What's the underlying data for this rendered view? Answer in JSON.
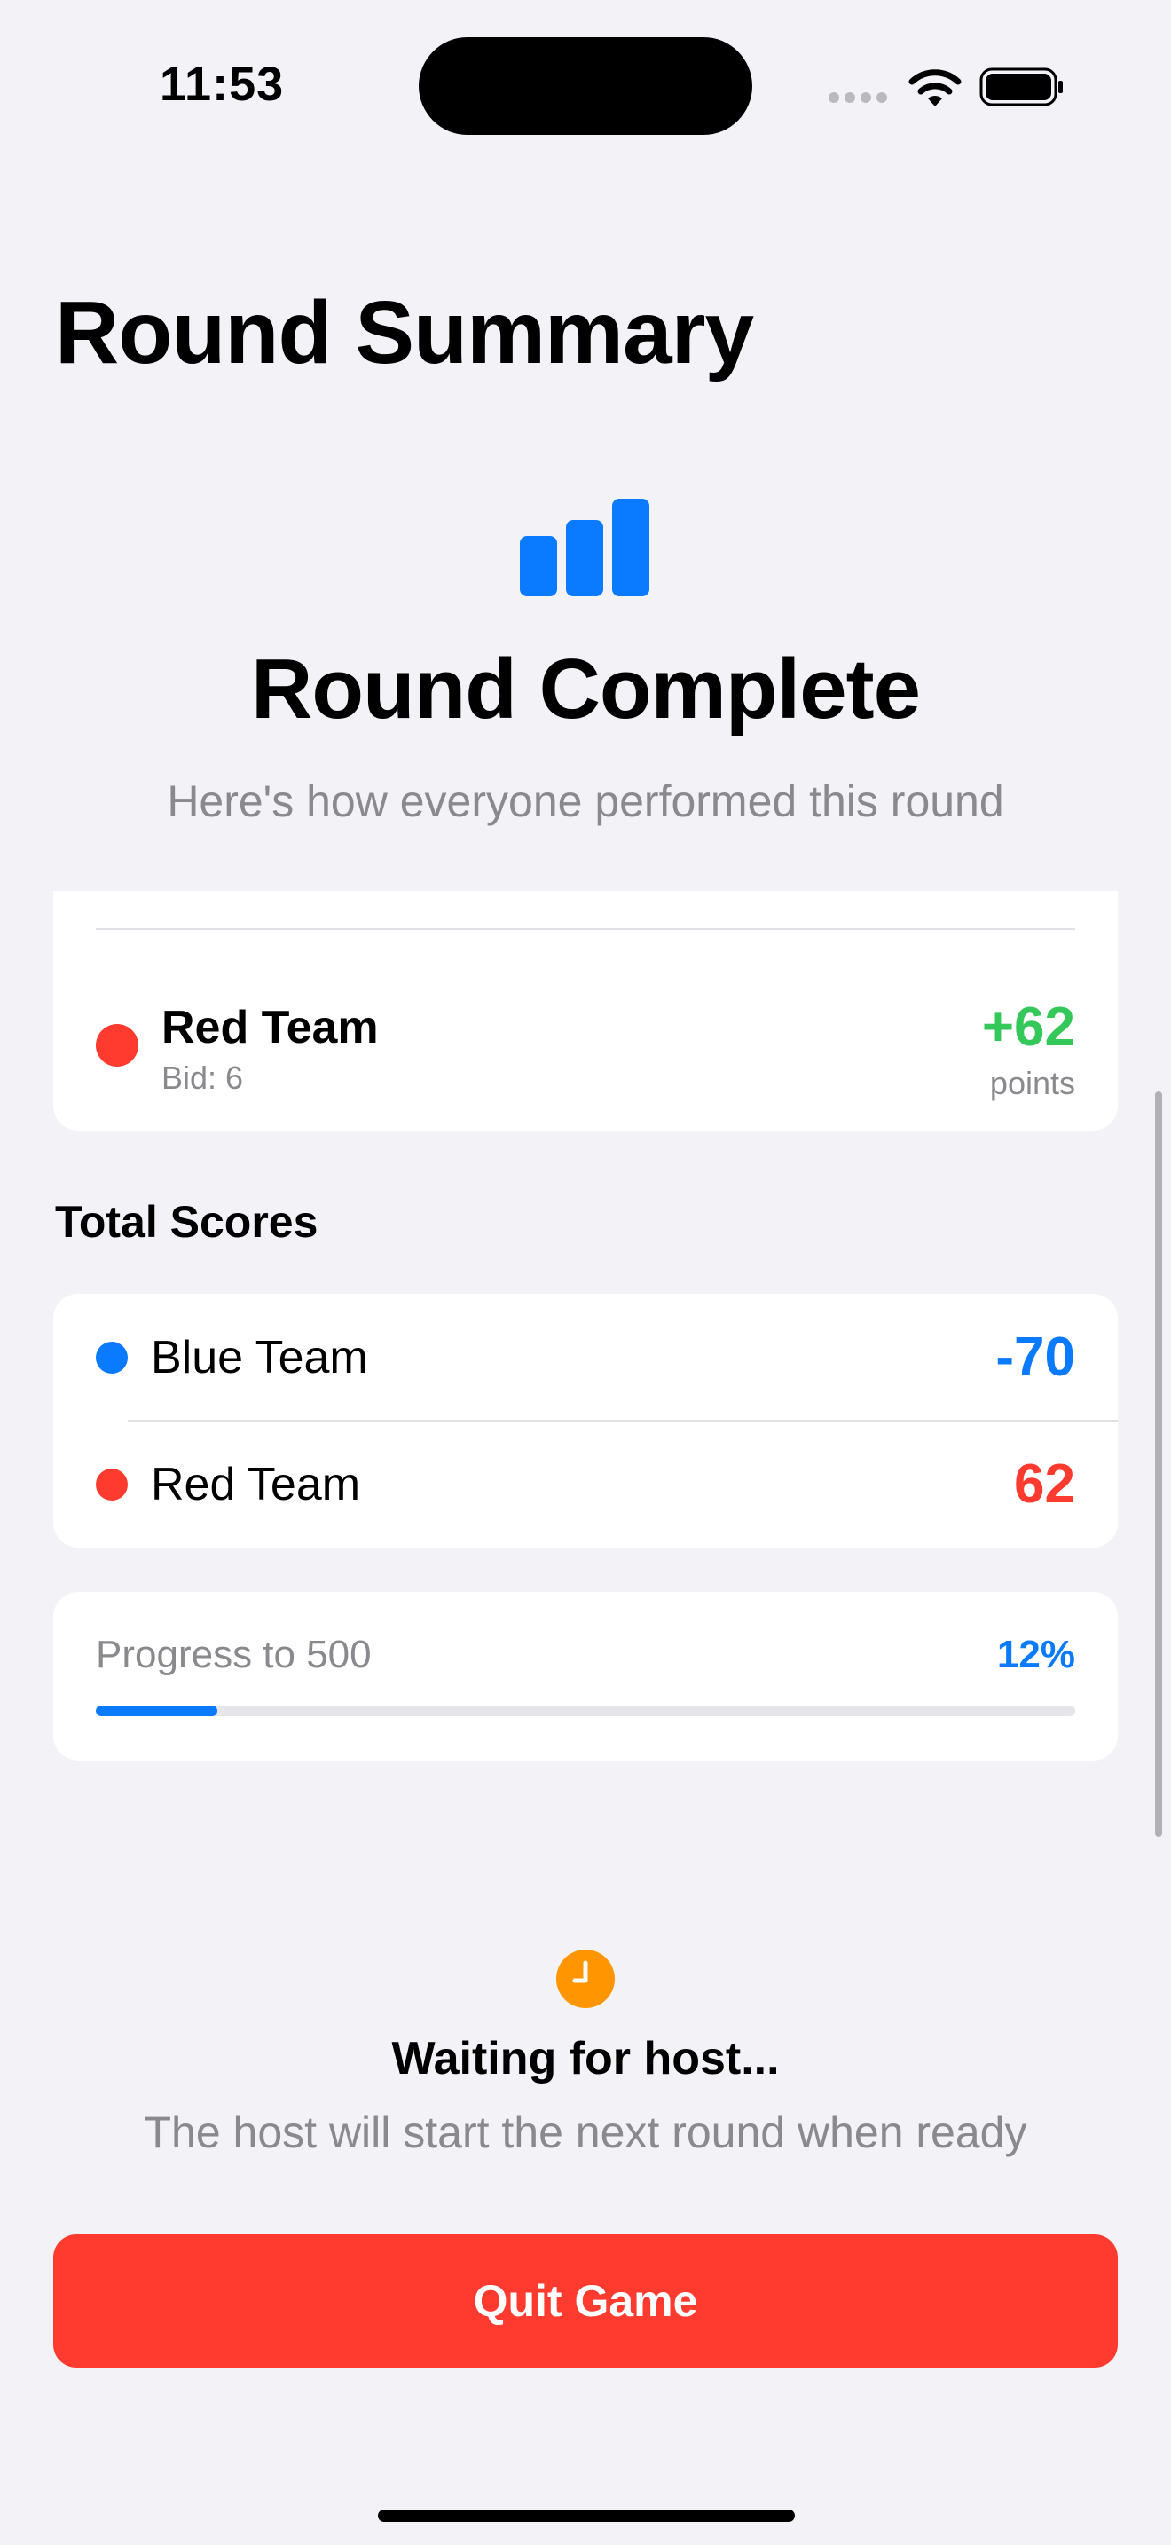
{
  "status_bar": {
    "time": "11:53"
  },
  "page": {
    "title": "Round Summary"
  },
  "hero": {
    "icon": "bar-chart-icon",
    "title": "Round Complete",
    "subtitle": "Here's how everyone performed this round"
  },
  "round_results": [
    {
      "team": "Red Team",
      "bid": "Bid: 6",
      "points": "+62",
      "points_label": "points",
      "color": "#ff3b30",
      "points_color": "#34c759"
    }
  ],
  "total_scores": {
    "heading": "Total Scores",
    "teams": [
      {
        "name": "Blue Team",
        "score": "-70",
        "color": "#0a7aff"
      },
      {
        "name": "Red Team",
        "score": "62",
        "color": "#ff3b30"
      }
    ]
  },
  "progress": {
    "label": "Progress to 500",
    "percent_text": "12%",
    "fraction": 0.124
  },
  "waiting": {
    "icon": "clock-icon",
    "title": "Waiting for host...",
    "subtitle": "The host will start the next round when ready"
  },
  "actions": {
    "quit_label": "Quit Game"
  },
  "colors": {
    "accent": "#0a7aff",
    "danger": "#ff3b30",
    "positive": "#34c759",
    "waiting": "#ff9500",
    "background": "#f2f2f7"
  }
}
